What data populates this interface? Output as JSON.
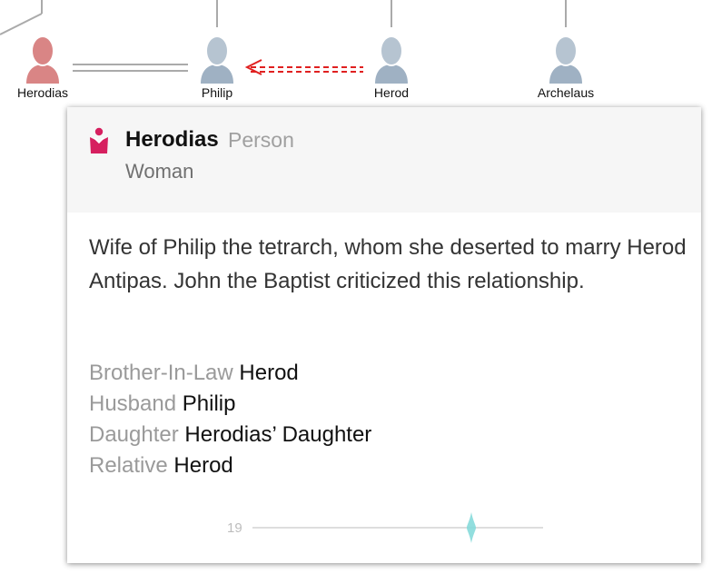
{
  "tree": {
    "nodes": [
      {
        "id": "herodias",
        "name": "Herodias",
        "color": "#d98585"
      },
      {
        "id": "philip",
        "name": "Philip",
        "color": "#a9bac9"
      },
      {
        "id": "herod",
        "name": "Herod",
        "color": "#a9bac9"
      },
      {
        "id": "archelaus",
        "name": "Archelaus",
        "color": "#a9bac9"
      }
    ],
    "marriage_line_color": "#aaaaaa",
    "relation_arrow_color": "#e02020"
  },
  "card": {
    "title": "Herodias",
    "kind": "Person",
    "subtitle": "Woman",
    "icon": "woman-icon",
    "icon_color": "#d61f5f",
    "description": "Wife of Philip the tetrarch, whom she deserted to marry Herod Antipas. John the Baptist criticized this relationship.",
    "relations": [
      {
        "type": "Brother-In-Law",
        "target": "Herod"
      },
      {
        "type": "Husband",
        "target": "Philip"
      },
      {
        "type": "Daughter",
        "target": "Herodias’ Daughter"
      },
      {
        "type": "Relative",
        "target": "Herod"
      }
    ],
    "timeline": {
      "label": "19",
      "marker_color": "#7fd8d8"
    }
  }
}
